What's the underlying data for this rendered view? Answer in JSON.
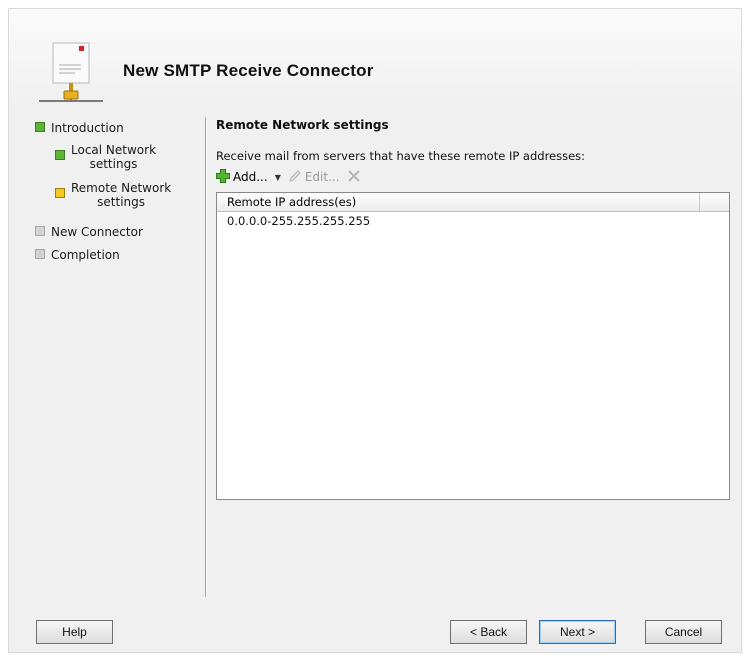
{
  "wizard": {
    "title": "New SMTP Receive Connector"
  },
  "nav": {
    "items": [
      {
        "label": "Introduction",
        "status": "completed"
      },
      {
        "label": "Local Network settings",
        "line1": "Local Network",
        "line2": "settings",
        "status": "completed"
      },
      {
        "label": "Remote Network settings",
        "line1": "Remote Network",
        "line2": "settings",
        "status": "current"
      },
      {
        "label": "New Connector",
        "status": "pending"
      },
      {
        "label": "Completion",
        "status": "pending"
      }
    ]
  },
  "main": {
    "section_title": "Remote Network settings",
    "description": "Receive mail from servers that have these remote IP addresses:",
    "toolbar": {
      "add_label": "Add...",
      "edit_label": "Edit..."
    },
    "list": {
      "column_header": "Remote IP address(es)",
      "rows": [
        "0.0.0.0-255.255.255.255"
      ]
    }
  },
  "footer": {
    "help_label": "Help",
    "back_label": "< Back",
    "next_label": "Next >",
    "cancel_label": "Cancel"
  },
  "colors": {
    "completed": "#5db535",
    "current": "#f4c81e",
    "pending": "#d3d3d3"
  },
  "icons": {
    "header": "network-connector-icon",
    "add": "plus-icon",
    "edit": "pencil-icon",
    "remove": "delete-x-icon"
  }
}
